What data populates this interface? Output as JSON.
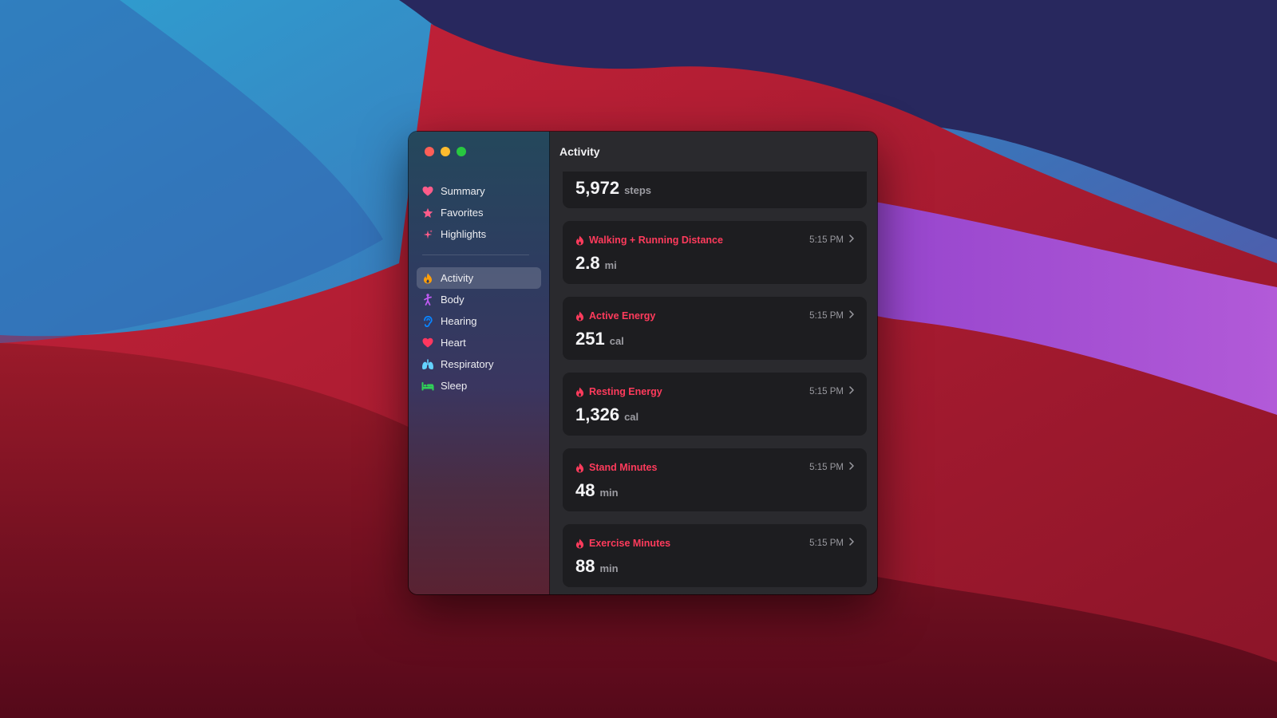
{
  "window": {
    "title": "Activity"
  },
  "sidebar": {
    "primary": [
      {
        "label": "Summary",
        "icon": "heart-icon",
        "color": "#ff5c8a"
      },
      {
        "label": "Favorites",
        "icon": "star-icon",
        "color": "#ff5c8a"
      },
      {
        "label": "Highlights",
        "icon": "sparkles-icon",
        "color": "#ff5c8a"
      }
    ],
    "categories": [
      {
        "label": "Activity",
        "icon": "flame-icon",
        "color": "#ff9f0a",
        "selected": true
      },
      {
        "label": "Body",
        "icon": "figure-icon",
        "color": "#bf5af2"
      },
      {
        "label": "Hearing",
        "icon": "ear-icon",
        "color": "#0a84ff"
      },
      {
        "label": "Heart",
        "icon": "heart-icon",
        "color": "#ff375f"
      },
      {
        "label": "Respiratory",
        "icon": "lungs-icon",
        "color": "#64d2ff"
      },
      {
        "label": "Sleep",
        "icon": "bed-icon",
        "color": "#30d158"
      }
    ]
  },
  "steps_card": {
    "value": "5,972",
    "unit": "steps"
  },
  "cards": [
    {
      "title": "Walking + Running Distance",
      "time": "5:15 PM",
      "value": "2.8",
      "unit": "mi"
    },
    {
      "title": "Active Energy",
      "time": "5:15 PM",
      "value": "251",
      "unit": "cal"
    },
    {
      "title": "Resting Energy",
      "time": "5:15 PM",
      "value": "1,326",
      "unit": "cal"
    },
    {
      "title": "Stand Minutes",
      "time": "5:15 PM",
      "value": "48",
      "unit": "min"
    },
    {
      "title": "Exercise Minutes",
      "time": "5:15 PM",
      "value": "88",
      "unit": "min"
    }
  ],
  "colors": {
    "accent": "#ff3b5c",
    "card_bg": "#1d1d20",
    "panel_bg": "#2a2a2e"
  }
}
